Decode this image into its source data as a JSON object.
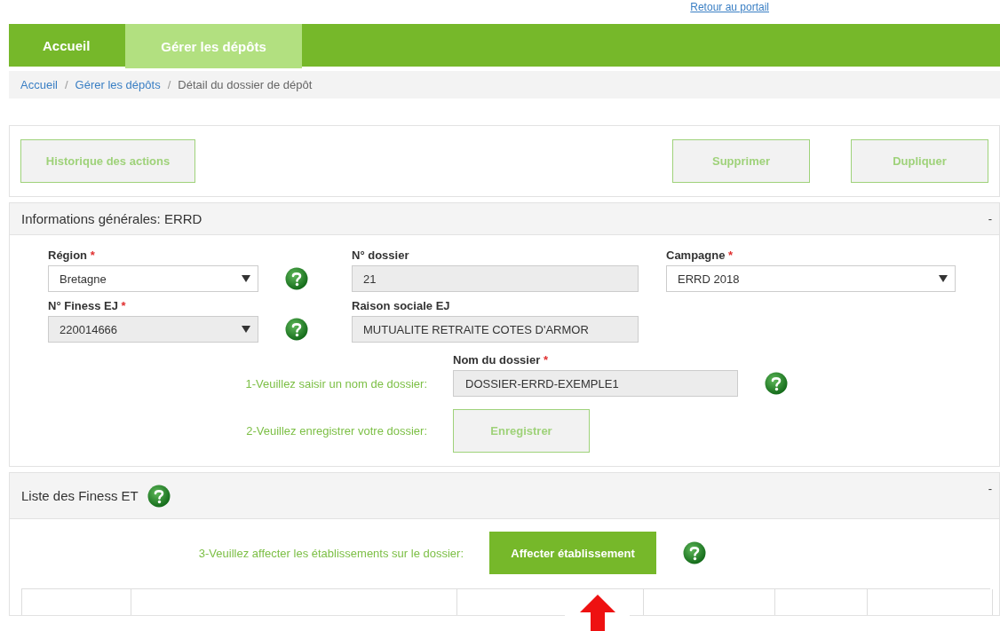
{
  "top_link": "Retour au portail",
  "nav_tabs": [
    {
      "label": "Accueil",
      "selected": false
    },
    {
      "label": "Gérer les dépôts",
      "selected": true
    }
  ],
  "breadcrumb": [
    {
      "kind": "link",
      "label": "Accueil"
    },
    {
      "kind": "separator",
      "label": "/"
    },
    {
      "kind": "link",
      "label": "Gérer les dépôts"
    },
    {
      "kind": "separator",
      "label": "/"
    },
    {
      "kind": "current",
      "label": "Détail du dossier de dépôt"
    }
  ],
  "actions": {
    "left": [
      "Historique des actions"
    ],
    "right": [
      "Supprimer",
      "Dupliquer"
    ]
  },
  "general_section": {
    "title": "Informations générales: ERRD",
    "toggle": "-",
    "fields": [
      {
        "label": "Région",
        "required_mark": "*",
        "kind": "select",
        "value": "Bretagne",
        "disabled": false,
        "help": true
      },
      {
        "label": "N° dossier",
        "kind": "input",
        "value": "21",
        "disabled": true,
        "help": false
      },
      {
        "label": "Campagne",
        "required_mark": "*",
        "kind": "select",
        "value": "ERRD 2018",
        "disabled": false,
        "help": false
      },
      {
        "label": "N° Finess EJ",
        "required_mark": "*",
        "kind": "select",
        "value": "220014666",
        "disabled": true,
        "help": true
      },
      {
        "label": "Raison sociale EJ",
        "kind": "input",
        "value": "MUTUALITE RETRAITE COTES D'ARMOR",
        "disabled": true,
        "help": false
      }
    ],
    "step1": {
      "instruction": "1-Veuillez saisir un nom de dossier:",
      "label": "Nom du dossier",
      "required_mark": "*",
      "value": "DOSSIER-ERRD-EXEMPLE1"
    },
    "step2": {
      "instruction": "2-Veuillez enregistrer votre dossier:",
      "button": "Enregistrer"
    }
  },
  "finess_section": {
    "title": "Liste des Finess ET",
    "toggle": "-",
    "step3": {
      "instruction": "3-Veuillez affecter les établissements sur le dossier:",
      "button": "Affecter établissement"
    }
  }
}
